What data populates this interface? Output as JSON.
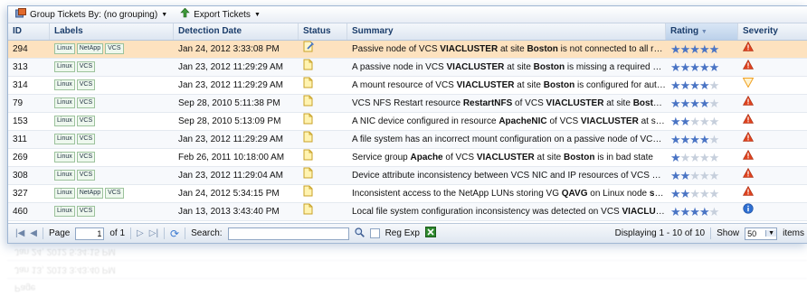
{
  "toolbar": {
    "group_label": "Group Tickets By: (no grouping)",
    "export_label": "Export Tickets"
  },
  "columns": {
    "id": "ID",
    "labels": "Labels",
    "date": "Detection Date",
    "status": "Status",
    "summary": "Summary",
    "rating": "Rating",
    "severity": "Severity"
  },
  "rows": [
    {
      "id": "294",
      "labels": [
        "Linux",
        "NetApp",
        "VCS"
      ],
      "date": "Jan 24, 2012 3:33:08 PM",
      "status": "note-edit",
      "summary": "Passive node of VCS VIACLUSTER at site Boston is not connected to all requir…",
      "rating": 5,
      "severity": "error"
    },
    {
      "id": "313",
      "labels": [
        "Linux",
        "VCS"
      ],
      "date": "Jan 23, 2012 11:29:29 AM",
      "status": "note",
      "summary": "A passive node in VCS VIACLUSTER at site Boston is missing a required mou…",
      "rating": 5,
      "severity": "error"
    },
    {
      "id": "314",
      "labels": [
        "Linux",
        "VCS"
      ],
      "date": "Jan 23, 2012 11:29:29 AM",
      "status": "note",
      "summary": "A mount resource of VCS VIACLUSTER at site Boston is configured for autom…",
      "rating": 4,
      "severity": "warning"
    },
    {
      "id": "79",
      "labels": [
        "Linux",
        "VCS"
      ],
      "date": "Sep 28, 2010 5:11:38 PM",
      "status": "note",
      "summary": "VCS NFS Restart resource RestartNFS of VCS VIACLUSTER at site Boston i…",
      "rating": 4,
      "severity": "error"
    },
    {
      "id": "153",
      "labels": [
        "Linux",
        "VCS"
      ],
      "date": "Sep 28, 2010 5:13:09 PM",
      "status": "note",
      "summary": "A NIC device configured in resource ApacheNIC of VCS VIACLUSTER at site B…",
      "rating": 2,
      "severity": "error"
    },
    {
      "id": "311",
      "labels": [
        "Linux",
        "VCS"
      ],
      "date": "Jan 23, 2012 11:29:29 AM",
      "status": "note",
      "summary": "A file system has an incorrect mount configuration on a passive node of VCS VI…",
      "rating": 4,
      "severity": "error"
    },
    {
      "id": "269",
      "labels": [
        "Linux",
        "VCS"
      ],
      "date": "Feb 26, 2011 10:18:00 AM",
      "status": "note",
      "summary": "Service group Apache of VCS VIACLUSTER at site Boston is in bad state",
      "rating": 1,
      "severity": "error"
    },
    {
      "id": "308",
      "labels": [
        "Linux",
        "VCS"
      ],
      "date": "Jan 23, 2012 11:29:04 AM",
      "status": "note",
      "summary": "Device attribute inconsistency between VCS NIC and IP resources of VCS VIAC…",
      "rating": 2,
      "severity": "error"
    },
    {
      "id": "327",
      "labels": [
        "Linux",
        "NetApp",
        "VCS"
      ],
      "date": "Jan 24, 2012 5:34:15 PM",
      "status": "note",
      "summary": "Inconsistent access to the NetApp LUNs storing VG QAVG on Linux node syste…",
      "rating": 2,
      "severity": "error"
    },
    {
      "id": "460",
      "labels": [
        "Linux",
        "VCS"
      ],
      "date": "Jan 13, 2013 3:43:40 PM",
      "status": "note",
      "summary": "Local file system configuration inconsistency was detected on VCS VIACLUST…",
      "rating": 4,
      "severity": "info"
    }
  ],
  "pager": {
    "page_label": "Page",
    "page_value": "1",
    "of_label": "of 1",
    "search_label": "Search:",
    "search_value": "",
    "regexp_label": "Reg Exp",
    "displaying": "Displaying 1 - 10 of 10",
    "show_label": "Show",
    "show_value": "50",
    "items_label": "items"
  },
  "icons": {
    "group": "group-tickets-icon",
    "export": "export-icon",
    "first": "first-page-icon",
    "prev": "prev-page-icon",
    "next": "next-page-icon",
    "last": "last-page-icon",
    "refresh": "refresh-icon",
    "search": "search-icon",
    "excel": "excel-icon"
  },
  "colors": {
    "selected_row": "#fde2bf",
    "star_on": "#4a74c4",
    "error": "#e0431f",
    "warning": "#f0a020",
    "info": "#2f6fd1"
  }
}
